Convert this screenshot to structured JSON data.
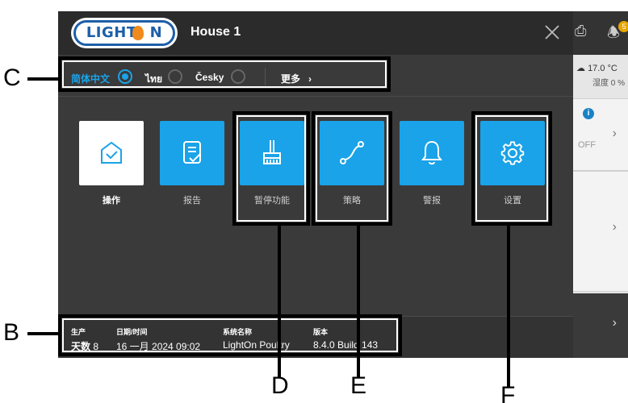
{
  "header": {
    "logo_text": "LIGHT",
    "logo_text_tail": "N",
    "title": "House 1",
    "close_icon": "close-icon"
  },
  "languages": [
    {
      "label": "简体中文",
      "selected": true
    },
    {
      "label": "ไทย",
      "selected": false
    },
    {
      "label": "Česky",
      "selected": false
    }
  ],
  "more_label": "更多",
  "more_chevron": "›",
  "tiles": [
    {
      "label": "操作",
      "icon": "house-check-icon",
      "selected": true
    },
    {
      "label": "报告",
      "icon": "report-icon",
      "selected": false
    },
    {
      "label": "暂停功能",
      "icon": "broom-icon",
      "selected": false
    },
    {
      "label": "策略",
      "icon": "curve-icon",
      "selected": false
    },
    {
      "label": "警报",
      "icon": "bell-icon",
      "selected": false
    },
    {
      "label": "设置",
      "icon": "gear-icon",
      "selected": false
    }
  ],
  "footer": {
    "production_label": "生产",
    "production_value_label": "天数",
    "production_value": "8",
    "datetime_label": "日期/时间",
    "datetime_value": "16 一月 2024 09:02",
    "system_label": "系统名称",
    "system_value": "LightOn Poultry",
    "version_label": "版本",
    "version_value": "8.4.0 Build 143"
  },
  "background": {
    "temperature": "17.0 °C",
    "humidity": "湿度 0 %",
    "badge": "5",
    "off_label": "OFF",
    "info": "i",
    "chevron": "›"
  },
  "annotations": {
    "b": "B",
    "c": "C",
    "d": "D",
    "e": "E",
    "f": "F"
  },
  "colors": {
    "accent": "#1aa3e8",
    "dialog_bg": "#3a3a3a",
    "header_bg": "#2b2b2b",
    "logo_blue": "#1d5fa8",
    "logo_orange": "#f08a1c"
  }
}
